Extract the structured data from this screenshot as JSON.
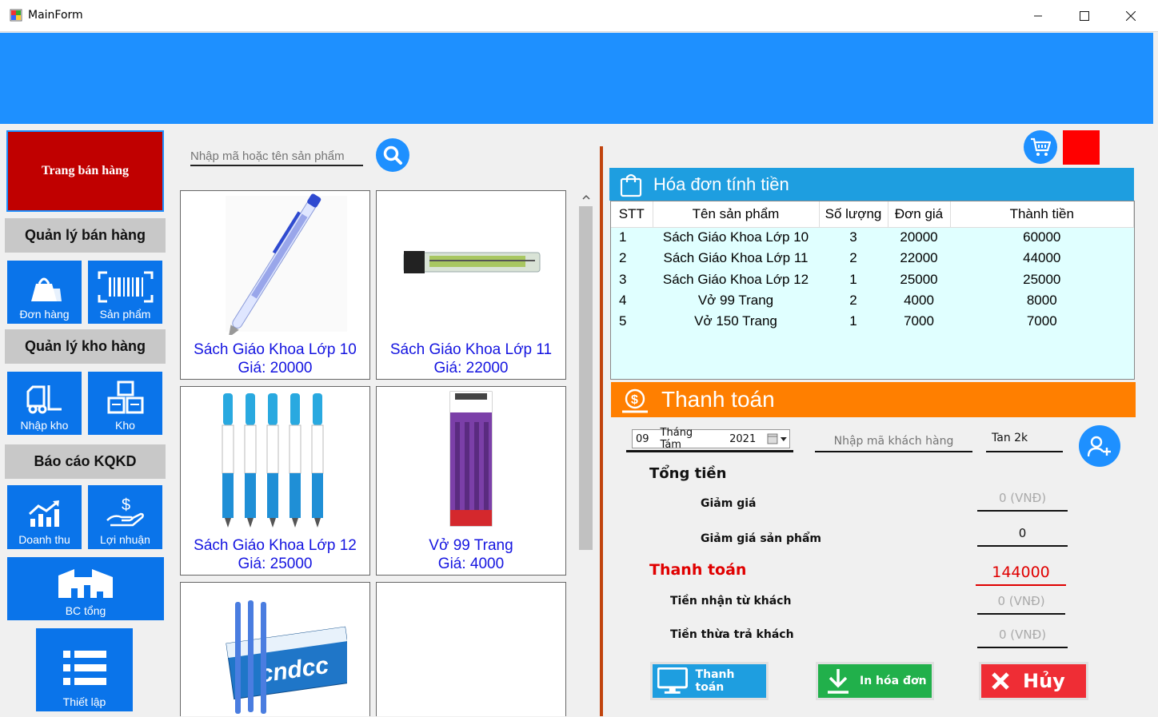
{
  "window": {
    "title": "MainForm"
  },
  "nav": {
    "home_label": "Trang bán hàng",
    "sales_section": "Quản lý bán hàng",
    "orders_label": "Đơn hàng",
    "products_label": "Sản phẩm",
    "warehouse_section": "Quản lý kho hàng",
    "import_label": "Nhập kho",
    "stock_label": "Kho",
    "report_section": "Báo cáo KQKD",
    "revenue_label": "Doanh thu",
    "profit_label": "Lợi nhuận",
    "summary_label": "BC tổng",
    "settings_label": "Thiết lập"
  },
  "search": {
    "placeholder": "Nhập mã hoặc tên sản phẩm"
  },
  "products": [
    {
      "name": "Sách Giáo Khoa Lớp 10",
      "price": "Giá: 20000"
    },
    {
      "name": "Sách Giáo Khoa Lớp 11",
      "price": "Giá: 22000"
    },
    {
      "name": "Sách Giáo Khoa Lớp 12",
      "price": "Giá: 25000"
    },
    {
      "name": "Vở 99 Trang",
      "price": "Giá: 4000"
    }
  ],
  "invoice": {
    "title": "Hóa đơn tính tiền",
    "columns": [
      "STT",
      "Tên sản phẩm",
      "Số lượng",
      "Đơn giá",
      "Thành tiền"
    ],
    "rows": [
      [
        "1",
        "Sách Giáo Khoa Lớp 10",
        "3",
        "20000",
        "60000"
      ],
      [
        "2",
        "Sách Giáo Khoa Lớp 11",
        "2",
        "22000",
        "44000"
      ],
      [
        "3",
        "Sách Giáo Khoa Lớp 12",
        "1",
        "25000",
        "25000"
      ],
      [
        "4",
        "Vở 99 Trang",
        "2",
        "4000",
        "8000"
      ],
      [
        "5",
        "Vở 150 Trang",
        "1",
        "7000",
        "7000"
      ]
    ]
  },
  "payment": {
    "title": "Thanh toán",
    "date_day": "09",
    "date_month": "Tháng Tám",
    "date_year": "2021",
    "customer_placeholder": "Nhập mã khách hàng",
    "customer_name": "Tan 2k",
    "total_label": "Tổng tiền",
    "discount_label": "Giảm giá",
    "discount_value": "0 (VNĐ)",
    "product_discount_label": "Giảm giá sản phẩm",
    "product_discount_value": "0",
    "pay_label": "Thanh toán",
    "pay_value": "144000",
    "received_label": "Tiền nhận từ khách",
    "received_value": "0 (VNĐ)",
    "change_label": "Tiền thừa trả khách",
    "change_value": "0 (VNĐ)",
    "btn_pay": "Thanh toán",
    "btn_print": "In hóa đơn",
    "btn_cancel": "Hủy"
  },
  "colors": {
    "header_blue": "#1e90ff",
    "tile_blue": "#0a74ea",
    "nav_red": "#c00000",
    "pay_orange": "#ff7f00",
    "invoice_blue": "#1e9ee0"
  }
}
